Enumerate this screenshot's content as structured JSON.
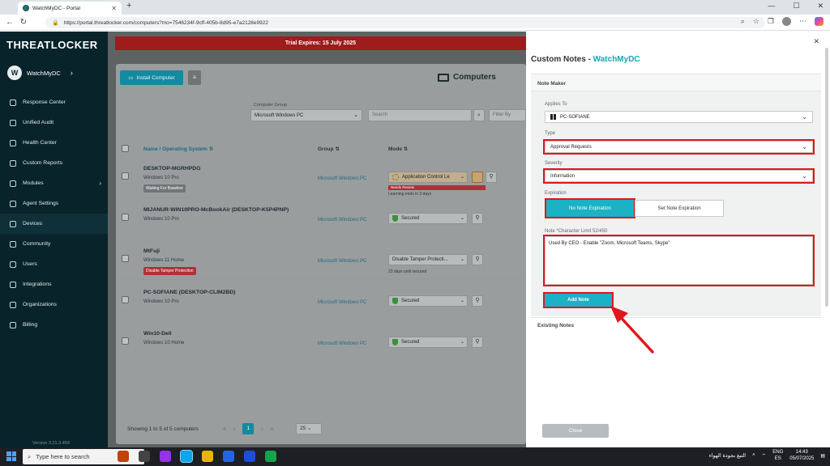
{
  "browser": {
    "tab_title": "WatchMyDC - Portal",
    "url": "https://portal.threatlocker.com/computers?mo=7546234f-9cff-405b-8d95-e7a2128e9922"
  },
  "sidebar": {
    "logo": "THREATLOCKER",
    "account_initial": "W",
    "account_name": "WatchMyDC",
    "items": [
      {
        "label": "Response Center"
      },
      {
        "label": "Unified Audit"
      },
      {
        "label": "Health Center"
      },
      {
        "label": "Custom Reports"
      },
      {
        "label": "Modules"
      },
      {
        "label": "Agent Settings"
      },
      {
        "label": "Devices"
      },
      {
        "label": "Community"
      },
      {
        "label": "Users"
      },
      {
        "label": "Integrations"
      },
      {
        "label": "Organizations"
      },
      {
        "label": "Billing"
      }
    ],
    "version": "Version 3.21.3.459"
  },
  "trial_banner": "Trial Expires: 15 July 2025",
  "main": {
    "install_label": "Install Computer",
    "page_title": "Computers",
    "computer_group_label": "Computer Group",
    "computer_group_value": "Microsoft Windows PC",
    "search_placeholder": "Search",
    "filter_placeholder": "Filter By",
    "col_name": "Name / Operating System",
    "col_group": "Group",
    "col_mode": "Mode",
    "rows": [
      {
        "name": "DESKTOP-MGRHPDG",
        "os": "Windows 10 Pro",
        "badge": "Waiting For Baseline",
        "group": "Microsoft Windows PC",
        "mode": "Application Control Le",
        "review": "Needs Review",
        "sub": "Learning ends in 3 days"
      },
      {
        "name": "MIJANUR-WIN10PRO-McBookAir (DESKTOP-K5P4PNP)",
        "os": "Windows 10 Pro",
        "group": "Microsoft Windows PC",
        "mode": "Secured"
      },
      {
        "name": "MtFuji",
        "os": "Windows 11 Home",
        "badge": "Disable Tamper Protection",
        "group": "Microsoft Windows PC",
        "mode": "Disable Tamper Protecti...",
        "sub": "23 days until secured"
      },
      {
        "name": "PC-SOFIANE (DESKTOP-CLIM2BD)",
        "os": "Windows 10 Pro",
        "group": "Microsoft Windows PC",
        "mode": "Secured"
      },
      {
        "name": "Win10-Dell",
        "os": "Windows 10 Home",
        "group": "Microsoft Windows PC",
        "mode": "Secured"
      }
    ],
    "showing": "Showing 1 to 5 of 5 computers",
    "current_page": "1",
    "per_page": "25"
  },
  "panel": {
    "title_prefix": "Custom Notes - ",
    "title_org": "WatchMyDC",
    "note_maker": "Note Maker",
    "applies_to_label": "Applies To",
    "applies_to_value": "PC-SOFIANE",
    "type_label": "Type",
    "type_value": "Approval Requests",
    "severity_label": "Severity",
    "severity_value": "Information",
    "expiration_label": "Expiration",
    "no_expiration": "No Note Expiration",
    "set_expiration": "Set Note Expiration",
    "note_label": "Note *Character Limit 52/450",
    "note_value": "Used By CEO - Enable \"Zoom, Microsoft Teams, Skype\"",
    "add_note": "Add Note",
    "existing_notes": "Existing Notes",
    "close": "Close"
  },
  "taskbar": {
    "search_placeholder": "Type here to search",
    "weather": "التبغ بجودة الهواء",
    "lang": "ENG",
    "region": "ES",
    "time": "14:43",
    "date": "05/07/2025"
  },
  "colors": {
    "sidebar_bg": "#08232a",
    "trial_banner": "#9e1c1c",
    "accent_teal": "#1ab2c4",
    "highlight_red": "#e1161c"
  }
}
